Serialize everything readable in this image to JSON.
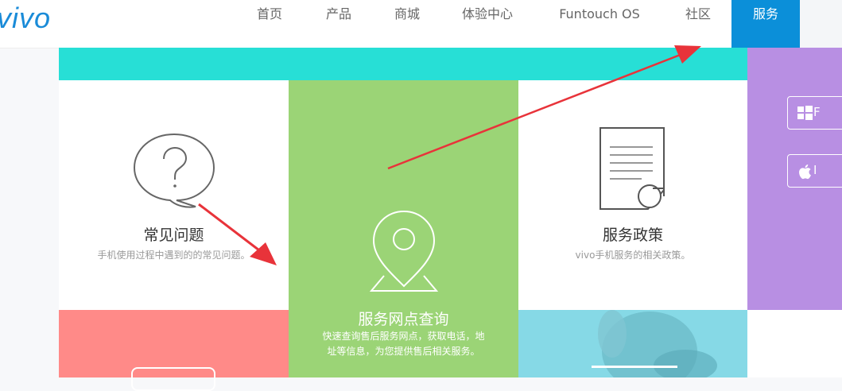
{
  "header": {
    "logo": "vivo",
    "nav": [
      {
        "label": "首页",
        "active": false
      },
      {
        "label": "产品",
        "active": false
      },
      {
        "label": "商城",
        "active": false
      },
      {
        "label": "体验中心",
        "active": false
      },
      {
        "label": "Funtouch OS",
        "active": false
      },
      {
        "label": "社区",
        "active": false
      },
      {
        "label": "服务",
        "active": true
      }
    ]
  },
  "cards": {
    "faq": {
      "title": "常见问题",
      "desc": "手机使用过程中遇到的的常见问题。",
      "icon": "question-bubble-icon"
    },
    "service_points": {
      "title": "服务网点查询",
      "desc": "快速查询售后服务网点，获取电话，地址等信息，为您提供售后相关服务。",
      "icon": "map-pin-icon"
    },
    "policy": {
      "title": "服务政策",
      "desc": "vivo手机服务的相关政策。",
      "icon": "document-icon"
    }
  },
  "downloads": {
    "windows_label": "F",
    "apple_label": "I"
  },
  "colors": {
    "brand": "#1a8bd8",
    "nav_active": "#0b8fd9",
    "teal": "#27dfd6",
    "purple": "#b88fe3",
    "green": "#9bd476",
    "pink": "#ff8a88",
    "arrow": "#e8333a"
  }
}
